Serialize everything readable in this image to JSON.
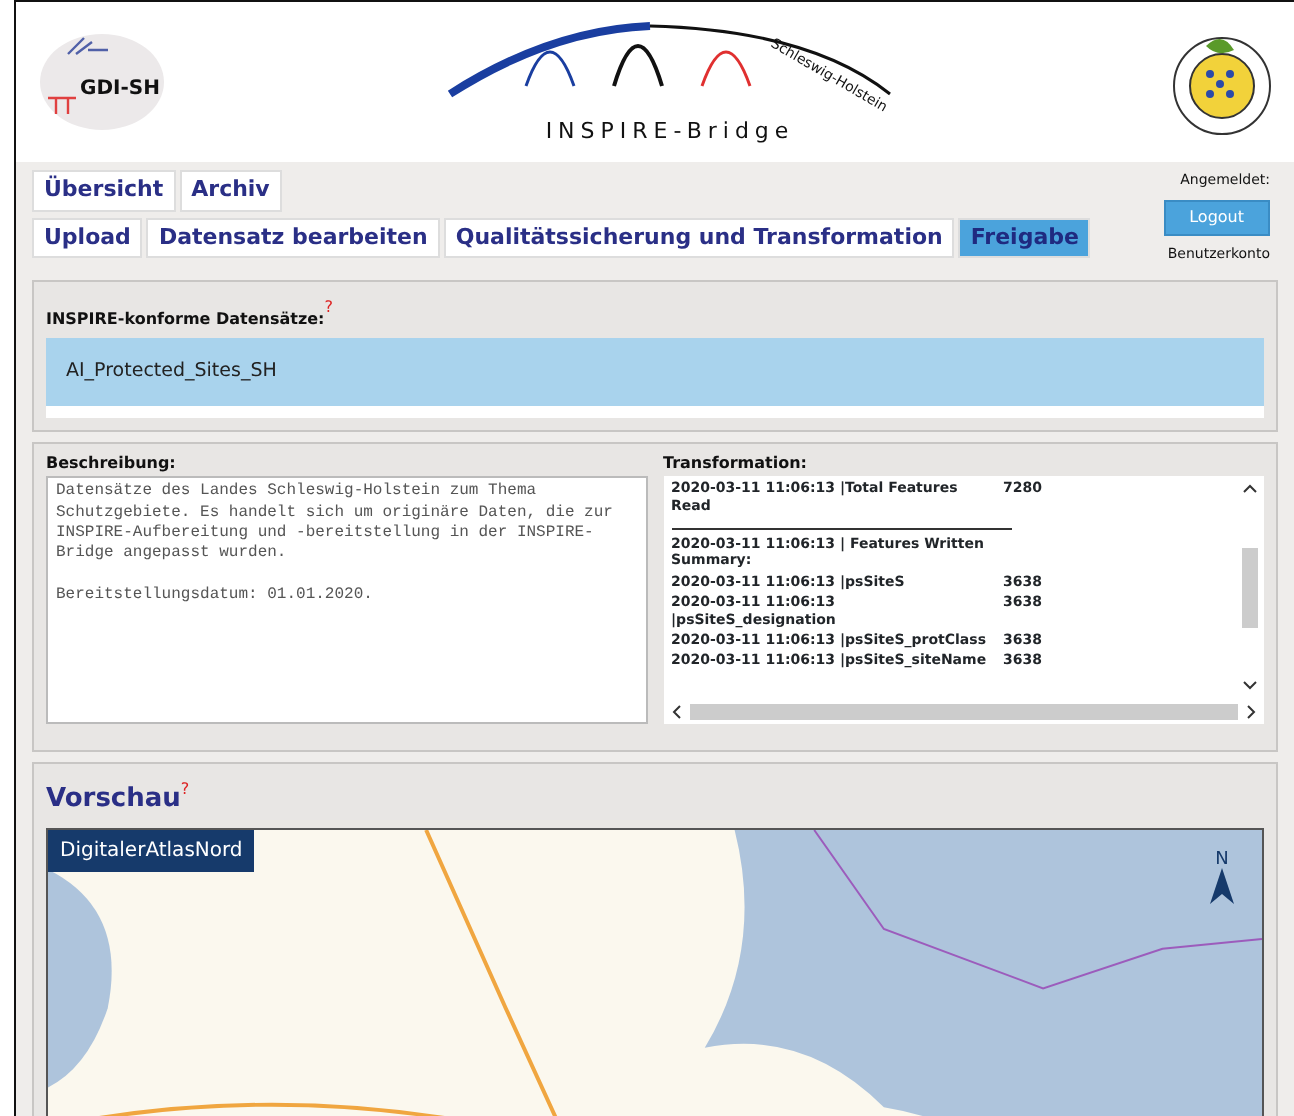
{
  "header": {
    "left_logo": "GDI-SH",
    "center_logo": {
      "arc_text": "Schleswig-Holstein",
      "title": "INSPIRE-Bridge"
    }
  },
  "tabs_row_1": [
    {
      "label": "Übersicht",
      "selected": false
    },
    {
      "label": "Archiv",
      "selected": false
    }
  ],
  "tabs_row_2": [
    {
      "label": "Upload",
      "selected": false
    },
    {
      "label": "Datensatz bearbeiten",
      "selected": false
    },
    {
      "label": "Qualitätssicherung und Transformation",
      "selected": false
    },
    {
      "label": "Freigabe",
      "selected": true
    }
  ],
  "user": {
    "label": "Angemeldet:",
    "logout": "Logout",
    "account": "Benutzerkonto"
  },
  "datasets": {
    "label": "INSPIRE-konforme Datensätze:",
    "help": "?",
    "items": [
      {
        "name": "AI_Protected_Sites_SH",
        "selected": true
      }
    ]
  },
  "description": {
    "label": "Beschreibung:",
    "text": "Datensätze des Landes Schleswig-Holstein zum Thema Schutzgebiete. Es handelt sich um originäre Daten, die zur INSPIRE-Aufbereitung und -bereitstellung in der INSPIRE-Bridge angepasst wurden.\n\nBereitstellungsdatum: 01.01.2020."
  },
  "transformation": {
    "label": "Transformation:",
    "rows": [
      {
        "text": "2020-03-11 11:06:13 |Total Features Read",
        "value": "7280",
        "rule_after": true
      },
      {
        "text": "2020-03-11 11:06:13 | Features Written Summary:",
        "rule_after": false
      },
      {
        "text": "2020-03-11 11:06:13 |psSiteS",
        "value": "3638",
        "rule_after": false
      },
      {
        "text": "2020-03-11 11:06:13 |psSiteS_designation",
        "value": "3638",
        "rule_after": false
      },
      {
        "text": "2020-03-11 11:06:13 |psSiteS_protClass",
        "value": "3638",
        "rule_after": false
      },
      {
        "text": "2020-03-11 11:06:13 |psSiteS_siteName",
        "value": "3638",
        "rule_after": false
      }
    ]
  },
  "preview": {
    "title": "Vorschau",
    "help": "?",
    "map": {
      "source_label": "DigitalerAtlasNord",
      "north_label": "N"
    }
  }
}
